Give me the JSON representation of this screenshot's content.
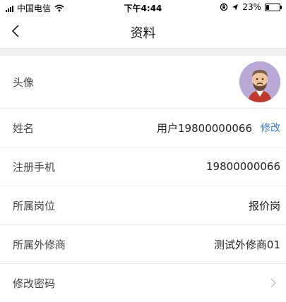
{
  "status_bar": {
    "carrier": "中国电信",
    "time": "下午4:44",
    "battery_percent": "23%",
    "battery_level": 0.23,
    "icons": [
      "signal-icon",
      "wifi-icon",
      "lock-rotation-icon",
      "location-icon",
      "battery-icon"
    ]
  },
  "nav": {
    "title": "资料",
    "back_icon": "chevron-left-icon"
  },
  "profile": {
    "avatar_label": "头像",
    "name_label": "姓名",
    "name_value": "用户19800000066",
    "name_edit": "修改",
    "phone_label": "注册手机",
    "phone_value": "19800000066"
  },
  "org": {
    "position_label": "所属岗位",
    "position_value": "报价岗",
    "vendor_label": "所属外修商",
    "vendor_value": "测试外修商01",
    "password_label": "修改密码"
  },
  "colors": {
    "accent": "#3a7bd5",
    "background": "#f2f2f2",
    "divider": "#ececec"
  }
}
